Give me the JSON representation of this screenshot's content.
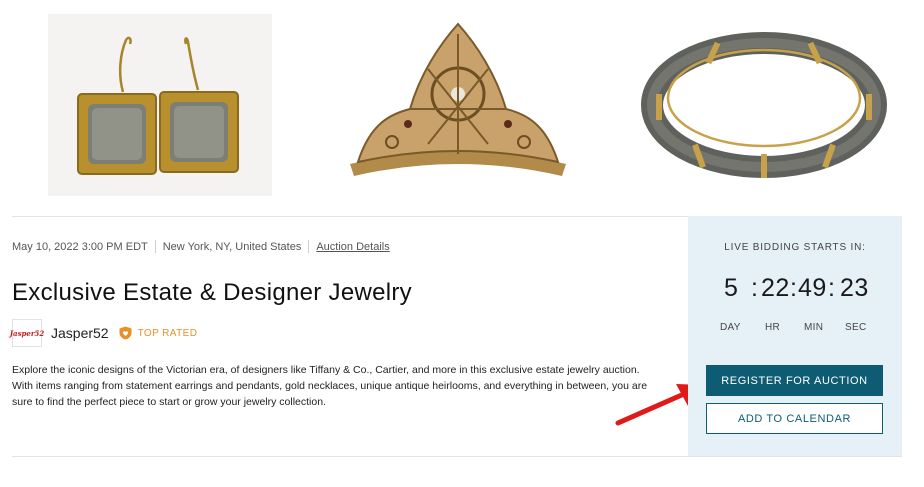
{
  "auction": {
    "date": "May 10, 2022 3:00 PM EDT",
    "location": "New York, NY, United States",
    "details_link": "Auction Details",
    "title": "Exclusive Estate & Designer Jewelry",
    "description": "Explore the iconic designs of the Victorian era, of designers like Tiffany & Co., Cartier, and more in this exclusive estate jewelry auction. With items ranging from statement earrings and pendants, gold necklaces, unique antique heirlooms, and everything in between, you are sure to find the perfect piece to start or grow your jewelry collection."
  },
  "seller": {
    "logo_text": "Jasper52",
    "name": "Jasper52",
    "badge_icon": "shield-heart-icon",
    "badge": "TOP RATED"
  },
  "bidding": {
    "label": "LIVE BIDDING STARTS IN:",
    "days": "5",
    "hours": "22",
    "minutes": "49",
    "seconds": "23",
    "days_label": "DAY",
    "hours_label": "HR",
    "minutes_label": "MIN",
    "seconds_label": "SEC",
    "register_label": "REGISTER FOR AUCTION",
    "calendar_label": "ADD TO CALENDAR"
  },
  "colors": {
    "accent": "#0d5c73",
    "panel_bg": "#e6f1f7",
    "badge": "#e8902a",
    "arrow": "#e0191b"
  }
}
